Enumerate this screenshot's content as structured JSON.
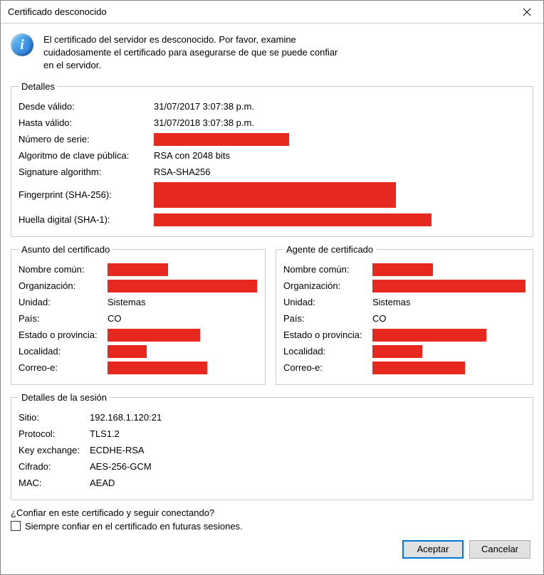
{
  "window": {
    "title": "Certificado desconocido"
  },
  "intro": "El certificado del servidor es desconocido. Por favor, examine cuidadosamente el certificado para asegurarse de que se puede confiar en el servidor.",
  "details": {
    "legend": "Detalles",
    "valid_from_label": "Desde válido:",
    "valid_from": "31/07/2017 3:07:38 p.m.",
    "valid_to_label": "Hasta válido:",
    "valid_to": "31/07/2018 3:07:38 p.m.",
    "serial_label": "Número de serie:",
    "pubkey_label": "Algoritmo de clave pública:",
    "pubkey": "RSA con 2048 bits",
    "sigalg_label": "Signature algorithm:",
    "sigalg": "RSA-SHA256",
    "fp256_label": "Fingerprint (SHA-256):",
    "fp1_label": "Huella digital (SHA-1):"
  },
  "subject": {
    "legend": "Asunto del certificado",
    "cn_label": "Nombre común:",
    "org_label": "Organización:",
    "unit_label": "Unidad:",
    "unit": "Sistemas",
    "country_label": "País:",
    "country": "CO",
    "state_label": "Estado o provincia:",
    "locality_label": "Localidad:",
    "email_label": "Correo-e:"
  },
  "issuer": {
    "legend": "Agente de certificado",
    "cn_label": "Nombre común:",
    "org_label": "Organización:",
    "unit_label": "Unidad:",
    "unit": "Sistemas",
    "country_label": "País:",
    "country": "CO",
    "state_label": "Estado o provincia:",
    "locality_label": "Localidad:",
    "email_label": "Correo-e:"
  },
  "session": {
    "legend": "Detalles de la sesión",
    "site_label": "Sitio:",
    "site": "192.168.1.120:21",
    "proto_label": "Protocol:",
    "proto": "TLS1.2",
    "kex_label": "Key exchange:",
    "kex": "ECDHE-RSA",
    "cipher_label": "Cifrado:",
    "cipher": "AES-256-GCM",
    "mac_label": "MAC:",
    "mac": "AEAD"
  },
  "question": "¿Confiar en este certificado y seguir conectando?",
  "always_trust_label": "Siempre confiar en el certificado en futuras sesiones.",
  "buttons": {
    "accept": "Aceptar",
    "cancel": "Cancelar"
  }
}
